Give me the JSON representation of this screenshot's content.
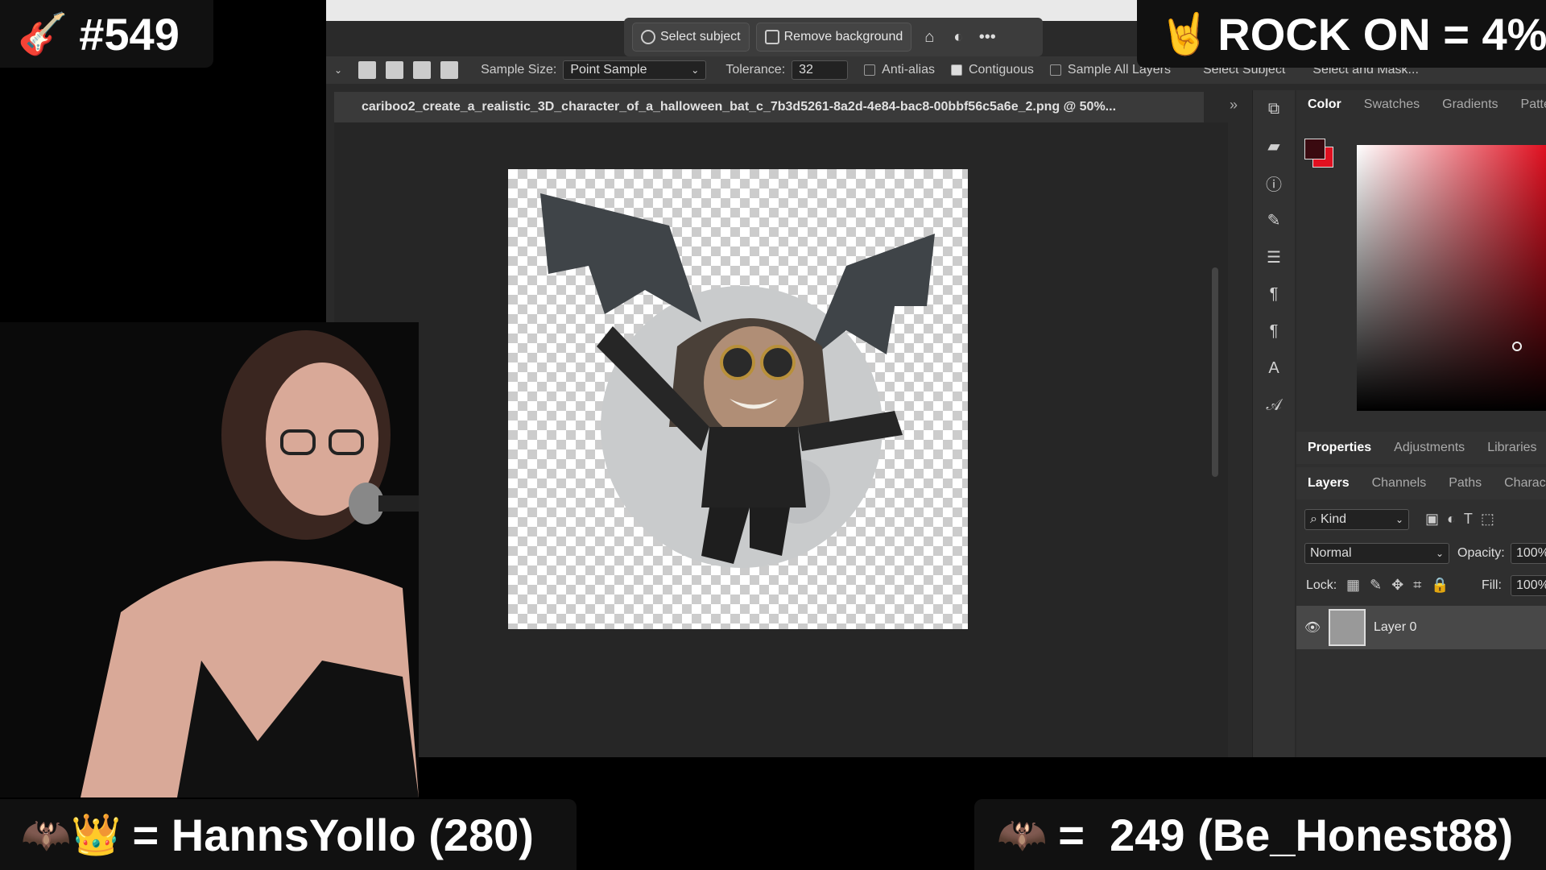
{
  "overlay": {
    "episode_emoji": "🎸",
    "episode": "#549",
    "rock_emoji": "🤘",
    "rock_on": "ROCK ON = 4%",
    "left_bar_emojis": "🦇👑",
    "left_bar": "= HannsYollo (280)",
    "right_bar_emoji": "🦇",
    "right_bar": "=  249 (Be_Honest88)"
  },
  "toolbar": {
    "select_subject": "Select subject",
    "remove_background": "Remove background",
    "more": "•••"
  },
  "options": {
    "sample_size_label": "Sample Size:",
    "sample_size_value": "Point Sample",
    "tolerance_label": "Tolerance:",
    "tolerance_value": "32",
    "anti_alias": "Anti-alias",
    "contiguous": "Contiguous",
    "sample_all_layers": "Sample All Layers",
    "select_subject_btn": "Select Subject",
    "select_and_mask": "Select and Mask..."
  },
  "document": {
    "tab_title": "cariboo2_create_a_realistic_3D_character_of_a_halloween_bat_c_7b3d5261-8a2d-4e84-bac8-00bbf56c5a6e_2.png @ 50%..."
  },
  "color_panel": {
    "tabs": [
      "Color",
      "Swatches",
      "Gradients",
      "Patte"
    ],
    "fg_color": "#3a0a10",
    "bg_color": "#e01020"
  },
  "properties_tabs": [
    "Properties",
    "Adjustments",
    "Libraries"
  ],
  "layers_panel": {
    "tabs": [
      "Layers",
      "Channels",
      "Paths",
      "Charact"
    ],
    "kind": "Kind",
    "blend_mode": "Normal",
    "opacity_label": "Opacity:",
    "opacity_value": "100%",
    "lock_label": "Lock:",
    "fill_label": "Fill:",
    "fill_value": "100%",
    "layer_name": "Layer 0"
  }
}
